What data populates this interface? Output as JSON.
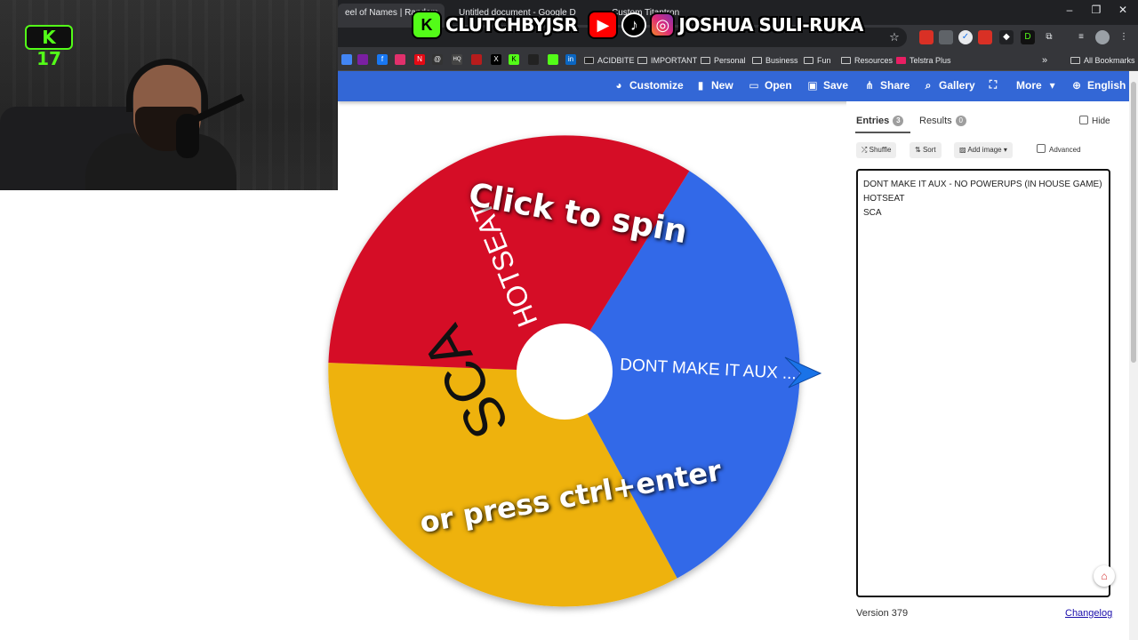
{
  "webcam": {
    "badge": "K 17"
  },
  "socials": {
    "kick_handle": "CLUTCHBYJSR",
    "name": "JOSHUA SULI-RUKA",
    "colors": {
      "kick": "#53fc18",
      "youtube": "#ff0000",
      "tiktok": "#000000",
      "instagram": "#e1306c"
    }
  },
  "browser": {
    "tabs": [
      {
        "label": "eel of Names | Random"
      },
      {
        "label": "Untitled document - Google D"
      },
      {
        "label": "Custom Titantron"
      }
    ],
    "window_controls": [
      "–",
      "❐",
      "✕"
    ],
    "bookmarks": [
      {
        "label": "ACIDBITE",
        "icon": "acidbite-icon"
      },
      {
        "label": "IMPORTANT",
        "icon": "folder-icon"
      },
      {
        "label": "Personal",
        "icon": "folder-icon"
      },
      {
        "label": "Business",
        "icon": "folder-icon"
      },
      {
        "label": "Fun",
        "icon": "folder-icon"
      },
      {
        "label": "Resources",
        "icon": "folder-icon"
      },
      {
        "label": "Telstra Plus",
        "icon": "telstra-icon"
      }
    ],
    "all_bookmarks": "All Bookmarks"
  },
  "toolbar": {
    "customize": "Customize",
    "new": "New",
    "open": "Open",
    "save": "Save",
    "share": "Share",
    "gallery": "Gallery",
    "more": "More",
    "language": "English",
    "accent": "#3367d6"
  },
  "wheel": {
    "prompt_top": "Click to spin",
    "prompt_bottom": "or press ctrl+enter",
    "segments": [
      {
        "label": "DONT MAKE IT AUX ...",
        "color": "#3369e8"
      },
      {
        "label": "SCA",
        "color": "#eeb211"
      },
      {
        "label": "HOTSEAT",
        "color": "#d50f25"
      }
    ]
  },
  "panel": {
    "entries_tab": "Entries",
    "entries_count": "3",
    "results_tab": "Results",
    "results_count": "0",
    "hide_label": "Hide",
    "shuffle": "Shuffle",
    "sort": "Sort",
    "add_image": "Add image",
    "advanced": "Advanced",
    "entries": [
      "DONT MAKE IT AUX - NO POWERUPS (IN HOUSE GAME)",
      "HOTSEAT",
      "SCA"
    ],
    "version": "Version 379",
    "changelog": "Changelog"
  }
}
